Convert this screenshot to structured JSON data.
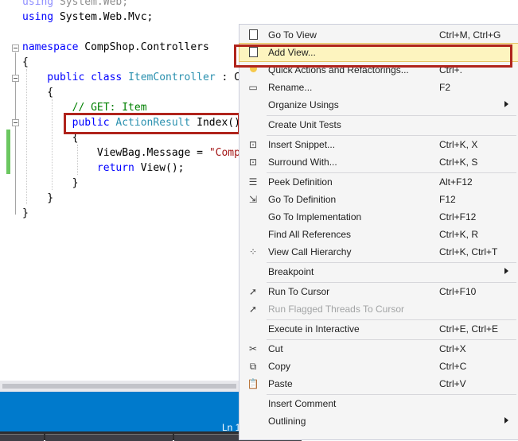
{
  "editor": {
    "lines": [
      {
        "parts": [
          {
            "t": "using",
            "c": "kw"
          },
          {
            "t": " System.Web;",
            "c": ""
          }
        ]
      },
      {
        "parts": [
          {
            "t": "using",
            "c": "kw"
          },
          {
            "t": " System.Web.Mvc;",
            "c": ""
          }
        ]
      },
      {
        "parts": []
      },
      {
        "parts": [
          {
            "t": "namespace",
            "c": "kw"
          },
          {
            "t": " CompShop.Controllers",
            "c": ""
          }
        ]
      },
      {
        "parts": [
          {
            "t": "{",
            "c": ""
          }
        ]
      },
      {
        "parts": [
          {
            "t": "    public",
            "c": "kw"
          },
          {
            "t": " ",
            "c": ""
          },
          {
            "t": "class",
            "c": "kw"
          },
          {
            "t": " ",
            "c": ""
          },
          {
            "t": "ItemController",
            "c": "ty"
          },
          {
            "t": " : C",
            "c": ""
          }
        ]
      },
      {
        "parts": [
          {
            "t": "    {",
            "c": ""
          }
        ]
      },
      {
        "parts": [
          {
            "t": "        // GET: Item",
            "c": "cm"
          }
        ]
      },
      {
        "parts": [
          {
            "t": "        public",
            "c": "kw"
          },
          {
            "t": " ",
            "c": ""
          },
          {
            "t": "ActionResult",
            "c": "ty"
          },
          {
            "t": " Index()",
            "c": ""
          }
        ]
      },
      {
        "parts": [
          {
            "t": "        {",
            "c": ""
          }
        ]
      },
      {
        "parts": [
          {
            "t": "            ViewBag.Message = ",
            "c": ""
          },
          {
            "t": "\"Comp",
            "c": "st"
          }
        ]
      },
      {
        "parts": [
          {
            "t": "            return",
            "c": "kw"
          },
          {
            "t": " View();",
            "c": ""
          }
        ]
      },
      {
        "parts": [
          {
            "t": "        }",
            "c": ""
          }
        ]
      },
      {
        "parts": [
          {
            "t": "    }",
            "c": ""
          }
        ]
      },
      {
        "parts": [
          {
            "t": "}",
            "c": ""
          }
        ]
      }
    ]
  },
  "status": {
    "position": "Ln 1"
  },
  "context_menu": {
    "items": [
      {
        "type": "item",
        "label": "Go To View",
        "shortcut": "Ctrl+M, Ctrl+G",
        "icon": "go-to-view-icon",
        "glyph": "box"
      },
      {
        "type": "item",
        "label": "Add View...",
        "shortcut": "",
        "icon": "add-view-icon",
        "glyph": "box",
        "highlight": true
      },
      {
        "type": "item",
        "label": "Quick Actions and Refactorings...",
        "shortcut": "Ctrl+.",
        "icon": "lightbulb-icon",
        "glyph": "bulb"
      },
      {
        "type": "item",
        "label": "Rename...",
        "shortcut": "F2",
        "icon": "rename-icon",
        "glyph": "▭"
      },
      {
        "type": "item",
        "label": "Organize Usings",
        "shortcut": "",
        "icon": "",
        "submenu": true
      },
      {
        "type": "sep"
      },
      {
        "type": "item",
        "label": "Create Unit Tests",
        "shortcut": "",
        "icon": ""
      },
      {
        "type": "sep"
      },
      {
        "type": "item",
        "label": "Insert Snippet...",
        "shortcut": "Ctrl+K, X",
        "icon": "insert-snippet-icon",
        "glyph": "⊡"
      },
      {
        "type": "item",
        "label": "Surround With...",
        "shortcut": "Ctrl+K, S",
        "icon": "surround-with-icon",
        "glyph": "⊡"
      },
      {
        "type": "sep"
      },
      {
        "type": "item",
        "label": "Peek Definition",
        "shortcut": "Alt+F12",
        "icon": "peek-definition-icon",
        "glyph": "☰"
      },
      {
        "type": "item",
        "label": "Go To Definition",
        "shortcut": "F12",
        "icon": "go-to-definition-icon",
        "glyph": "⇲"
      },
      {
        "type": "item",
        "label": "Go To Implementation",
        "shortcut": "Ctrl+F12",
        "icon": ""
      },
      {
        "type": "item",
        "label": "Find All References",
        "shortcut": "Ctrl+K, R",
        "icon": ""
      },
      {
        "type": "item",
        "label": "View Call Hierarchy",
        "shortcut": "Ctrl+K, Ctrl+T",
        "icon": "call-hierarchy-icon",
        "glyph": "⁘"
      },
      {
        "type": "sep"
      },
      {
        "type": "item",
        "label": "Breakpoint",
        "shortcut": "",
        "icon": "",
        "submenu": true
      },
      {
        "type": "sep"
      },
      {
        "type": "item",
        "label": "Run To Cursor",
        "shortcut": "Ctrl+F10",
        "icon": "run-to-cursor-icon",
        "glyph": "➚"
      },
      {
        "type": "item",
        "label": "Run Flagged Threads To Cursor",
        "shortcut": "",
        "icon": "run-flagged-threads-icon",
        "glyph": "➚",
        "disabled": true
      },
      {
        "type": "sep"
      },
      {
        "type": "item",
        "label": "Execute in Interactive",
        "shortcut": "Ctrl+E, Ctrl+E",
        "icon": ""
      },
      {
        "type": "sep"
      },
      {
        "type": "item",
        "label": "Cut",
        "shortcut": "Ctrl+X",
        "icon": "cut-icon",
        "glyph": "✂"
      },
      {
        "type": "item",
        "label": "Copy",
        "shortcut": "Ctrl+C",
        "icon": "copy-icon",
        "glyph": "⧉"
      },
      {
        "type": "item",
        "label": "Paste",
        "shortcut": "Ctrl+V",
        "icon": "paste-icon",
        "glyph": "📋"
      },
      {
        "type": "sep"
      },
      {
        "type": "item",
        "label": "Insert Comment",
        "shortcut": "",
        "icon": ""
      },
      {
        "type": "item",
        "label": "Outlining",
        "shortcut": "",
        "icon": "",
        "submenu": true
      }
    ]
  }
}
